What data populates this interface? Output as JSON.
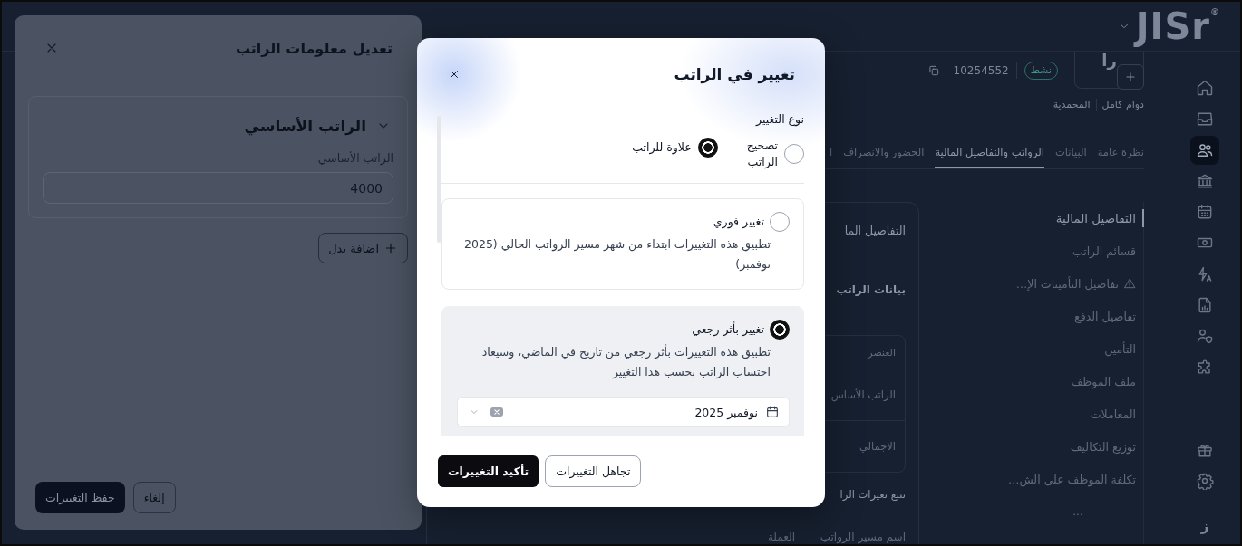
{
  "app": {
    "logo": "JISr$^{®}$",
    "sidebar": {
      "top": [
        {
          "selected": false
        },
        {
          "selected": false
        },
        {
          "selected": true
        },
        {
          "selected": false
        },
        {
          "selected": false
        },
        {
          "selected": false
        },
        {
          "selected": false
        },
        {
          "selected": false
        },
        {
          "selected": false
        },
        {
          "selected": false
        }
      ],
      "bottom": [
        {
          "selected": false
        },
        {
          "selected": false
        }
      ],
      "user_initial": "ز"
    },
    "employee": {
      "initials": "را",
      "status": "نشط",
      "id": "10254552",
      "contract": "دوام كامل",
      "branch": "المحمدية"
    },
    "tabs": [
      {
        "label": "نظرة عامة",
        "selected": false
      },
      {
        "label": "البيانات",
        "selected": false
      },
      {
        "label": "الرواتب والتفاصيل المالية",
        "selected": true
      },
      {
        "label": "الحضور والانصراف",
        "selected": false
      },
      {
        "label": "ا",
        "selected": false
      }
    ],
    "section_nav": {
      "items": [
        {
          "label": "التفاصيل المالية",
          "selected": true,
          "warning": false
        },
        {
          "label": "قسائم الراتب",
          "selected": false,
          "warning": false
        },
        {
          "label": "تفاصيل التأمينات الإ…",
          "selected": false,
          "warning": true
        },
        {
          "label": "تفاصيل الدفع",
          "selected": false,
          "warning": false
        },
        {
          "label": "التأمين",
          "selected": false,
          "warning": false
        },
        {
          "label": "ملف الموظف",
          "selected": false,
          "warning": false
        },
        {
          "label": "المعاملات",
          "selected": false,
          "warning": false
        },
        {
          "label": "توزيع التكاليف",
          "selected": false,
          "warning": false
        },
        {
          "label": "تكلفة الموظف على الش…",
          "selected": false,
          "warning": false
        }
      ],
      "more": "..."
    },
    "panel": {
      "title": "التفاصيل الما",
      "subtitle": "بيانات الراتب",
      "table": {
        "header": "العنصر",
        "rows": [
          "الراتب الأساس",
          "الاجمالي"
        ]
      },
      "history_title": "تتبع تغيرات الرا",
      "history_columns": [
        "اسم مسير الرواتب",
        "العملة"
      ]
    }
  },
  "drawer": {
    "title": "تعديل معلومات الراتب",
    "section": {
      "title": "الراتب الأساسي",
      "expanded": true,
      "field_label": "الراتب الأساسي",
      "value": "4000"
    },
    "add_button": "اضافة بدل",
    "buttons": [
      {
        "label": "إلغاء",
        "kind": "secondary"
      },
      {
        "label": "حفظ التغييرات",
        "kind": "primary"
      }
    ]
  },
  "dialog": {
    "title": "تغيير في الراتب",
    "change_type": {
      "label": "نوع التغيير",
      "options": [
        {
          "label": "تصحيح الراتب",
          "selected": false
        },
        {
          "label": "علاوة للراتب",
          "selected": true
        }
      ]
    },
    "timing": [
      {
        "title": "تغيير فوري",
        "description": "تطبيق هذه التغييرات ابتداء من شهر مسير الرواتب الحالي (2025 نوفمبر)",
        "selected": false
      },
      {
        "title": "تغيير بأثر رجعي",
        "description": "تطبيق هذه التغييرات بأثر رجعي من تاريخ في الماضي، وسيعاد احتساب الراتب بحسب هذا التغيير",
        "selected": true,
        "month": "نوفمبر 2025"
      }
    ],
    "buttons": [
      {
        "label": "تجاهل التغييرات",
        "kind": "secondary"
      },
      {
        "label": "تأكيد التغييرات",
        "kind": "primary"
      }
    ]
  }
}
